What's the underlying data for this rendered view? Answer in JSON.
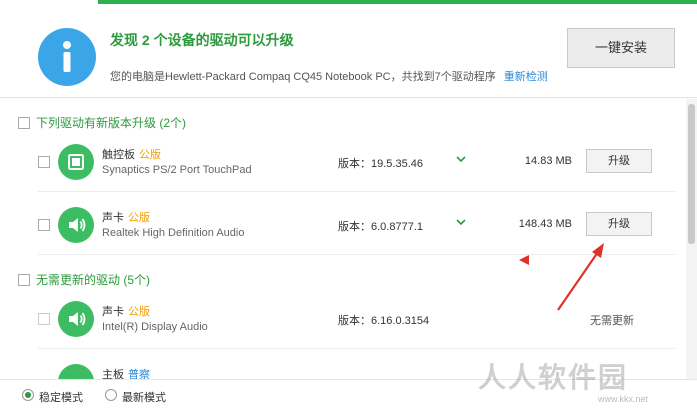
{
  "header": {
    "title": "发现 2 个设备的驱动可以升级",
    "subtitle": "您的电脑是Hewlett-Packard Compaq CQ45 Notebook PC，共找到7个驱动程序",
    "rescan_link": "重新检测",
    "install_button": "一键安装"
  },
  "upgrade_section": {
    "label": "下列驱动有新版本升级 (2个)",
    "rows": [
      {
        "name": "触控板",
        "tag": "公版",
        "model": "Synaptics PS/2 Port TouchPad",
        "version": "版本：19.5.35.46",
        "size": "14.83 MB",
        "button": "升级",
        "icon": "touchpad-icon"
      },
      {
        "name": "声卡",
        "tag": "公版",
        "model": "Realtek High Definition Audio",
        "version": "版本：6.0.8777.1",
        "size": "148.43 MB",
        "button": "升级",
        "icon": "speaker-icon"
      }
    ]
  },
  "uptodate_section": {
    "label": "无需更新的驱动 (5个)",
    "rows": [
      {
        "name": "声卡",
        "tag": "公版",
        "model": "Intel(R) Display Audio",
        "version": "版本：6.16.0.3154",
        "status": "无需更新",
        "icon": "speaker-icon"
      },
      {
        "name": "主板",
        "tag": "普察",
        "icon": "motherboard-icon"
      }
    ]
  },
  "bottom": {
    "mode_stable": "稳定模式",
    "mode_latest": "最新模式",
    "selected": "stable"
  },
  "watermark": {
    "text": "人人软件园",
    "url": "www.kkx.net"
  },
  "colors": {
    "accent_green": "#2c9a3d",
    "icon_blue": "#3aa6e8",
    "icon_green": "#3cbd63",
    "tag_orange": "#f0a000",
    "link_blue": "#2a88d6",
    "annotation_red": "#e0322a"
  }
}
